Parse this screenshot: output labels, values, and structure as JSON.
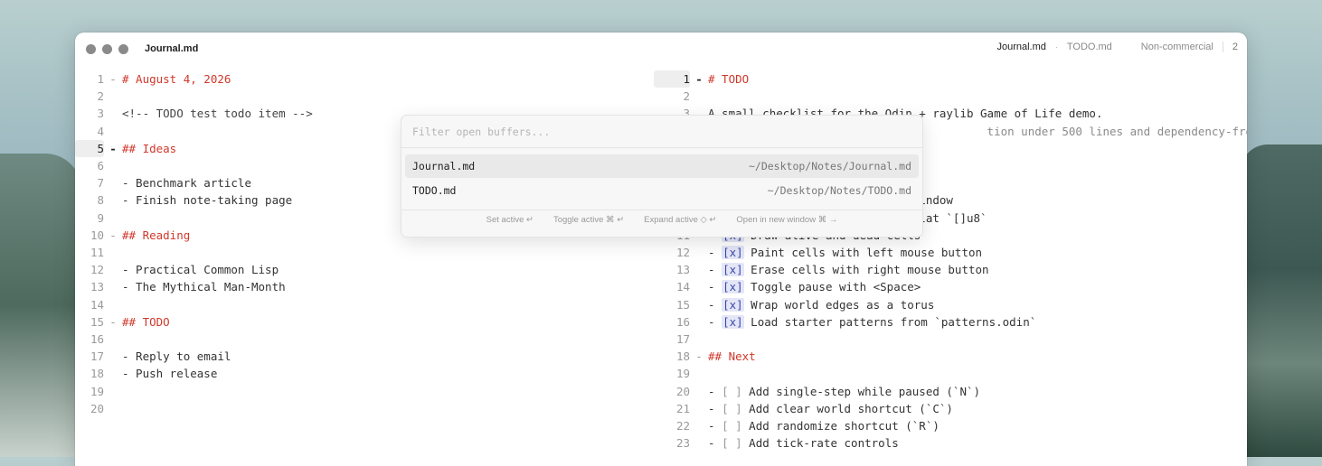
{
  "window": {
    "title": "Journal.md",
    "tabs": [
      {
        "label": "Journal.md",
        "active": true
      },
      {
        "label": "TODO.md",
        "active": false
      }
    ],
    "tab_separator": "·",
    "license": "Non-commercial",
    "pane_count": "2"
  },
  "left_pane": {
    "lines": [
      {
        "n": "1",
        "fold": "-",
        "text": "# August 4, 2026",
        "kind": "heading"
      },
      {
        "n": "2",
        "fold": "",
        "text": "",
        "kind": "plain"
      },
      {
        "n": "3",
        "fold": "",
        "text": "<!-- TODO test todo item -->",
        "kind": "comment"
      },
      {
        "n": "4",
        "fold": "",
        "text": "",
        "kind": "plain"
      },
      {
        "n": "5",
        "fold": "-",
        "text": "## Ideas",
        "kind": "heading",
        "current": true
      },
      {
        "n": "6",
        "fold": "",
        "text": "",
        "kind": "plain"
      },
      {
        "n": "7",
        "fold": "",
        "text": "- Benchmark article",
        "kind": "plain"
      },
      {
        "n": "8",
        "fold": "",
        "text": "- Finish note-taking page",
        "kind": "plain"
      },
      {
        "n": "9",
        "fold": "",
        "text": "",
        "kind": "plain"
      },
      {
        "n": "10",
        "fold": "-",
        "text": "## Reading",
        "kind": "heading"
      },
      {
        "n": "11",
        "fold": "",
        "text": "",
        "kind": "plain"
      },
      {
        "n": "12",
        "fold": "",
        "text": "- Practical Common Lisp",
        "kind": "plain"
      },
      {
        "n": "13",
        "fold": "",
        "text": "- The Mythical Man-Month",
        "kind": "plain"
      },
      {
        "n": "14",
        "fold": "",
        "text": "",
        "kind": "plain"
      },
      {
        "n": "15",
        "fold": "-",
        "text": "## TODO",
        "kind": "heading"
      },
      {
        "n": "16",
        "fold": "",
        "text": "",
        "kind": "plain"
      },
      {
        "n": "17",
        "fold": "",
        "text": "- Reply to email",
        "kind": "plain"
      },
      {
        "n": "18",
        "fold": "",
        "text": "- Push release",
        "kind": "plain"
      },
      {
        "n": "19",
        "fold": "",
        "text": "",
        "kind": "plain"
      },
      {
        "n": "20",
        "fold": "",
        "text": "",
        "kind": "plain"
      }
    ]
  },
  "right_pane": {
    "lines": [
      {
        "n": "1",
        "fold": "-",
        "text": "# TODO",
        "kind": "heading",
        "current": true
      },
      {
        "n": "2",
        "fold": "",
        "text": "",
        "kind": "plain"
      },
      {
        "n": "3",
        "fold": "",
        "text": "A small checklist for the Odin + raylib Game of Life demo.",
        "kind": "plain"
      },
      {
        "n": "",
        "fold": "",
        "text": "                                         tion under 500 lines and dependency-free.",
        "kind": "dim"
      },
      {
        "n": "",
        "fold": "",
        "text": "",
        "kind": "plain"
      },
      {
        "n": "",
        "fold": "",
        "text": "",
        "kind": "plain"
      },
      {
        "n": "",
        "fold": "",
        "text": "",
        "kind": "plain"
      },
      {
        "n": "",
        "fold": "",
        "text": "                            b window",
        "kind": "plain"
      },
      {
        "n": "",
        "fold": "",
        "text": "                            u flat `[]u8`",
        "kind": "plain"
      },
      {
        "n": "11",
        "fold": "",
        "pre": "- ",
        "box": "[x]",
        "text": " Draw alive and dead cells",
        "kind": "done"
      },
      {
        "n": "12",
        "fold": "",
        "pre": "- ",
        "box": "[x]",
        "text": " Paint cells with left mouse button",
        "kind": "done"
      },
      {
        "n": "13",
        "fold": "",
        "pre": "- ",
        "box": "[x]",
        "text": " Erase cells with right mouse button",
        "kind": "done"
      },
      {
        "n": "14",
        "fold": "",
        "pre": "- ",
        "box": "[x]",
        "text": " Toggle pause with <Space>",
        "kind": "done"
      },
      {
        "n": "15",
        "fold": "",
        "pre": "- ",
        "box": "[x]",
        "text": " Wrap world edges as a torus",
        "kind": "done"
      },
      {
        "n": "16",
        "fold": "",
        "pre": "- ",
        "box": "[x]",
        "text": " Load starter patterns from `patterns.odin`",
        "kind": "done"
      },
      {
        "n": "17",
        "fold": "",
        "text": "",
        "kind": "plain"
      },
      {
        "n": "18",
        "fold": "-",
        "text": "## Next",
        "kind": "heading"
      },
      {
        "n": "19",
        "fold": "",
        "text": "",
        "kind": "plain"
      },
      {
        "n": "20",
        "fold": "",
        "pre": "- ",
        "box": "[ ]",
        "text": " Add single-step while paused (`N`)",
        "kind": "open"
      },
      {
        "n": "21",
        "fold": "",
        "pre": "- ",
        "box": "[ ]",
        "text": " Add clear world shortcut (`C`)",
        "kind": "open"
      },
      {
        "n": "22",
        "fold": "",
        "pre": "- ",
        "box": "[ ]",
        "text": " Add randomize shortcut (`R`)",
        "kind": "open"
      },
      {
        "n": "23",
        "fold": "",
        "pre": "- ",
        "box": "[ ]",
        "text": " Add tick-rate controls",
        "kind": "open"
      }
    ]
  },
  "switcher": {
    "placeholder": "Filter open buffers...",
    "items": [
      {
        "name": "Journal.md",
        "path": "~/Desktop/Notes/Journal.md",
        "active": true
      },
      {
        "name": "TODO.md",
        "path": "~/Desktop/Notes/TODO.md",
        "active": false
      }
    ],
    "footer": [
      {
        "label": "Set active ↵"
      },
      {
        "label": "Toggle active ⌘ ↵"
      },
      {
        "label": "Expand active ◇ ↵"
      },
      {
        "label": "Open in new window ⌘ →"
      }
    ]
  }
}
